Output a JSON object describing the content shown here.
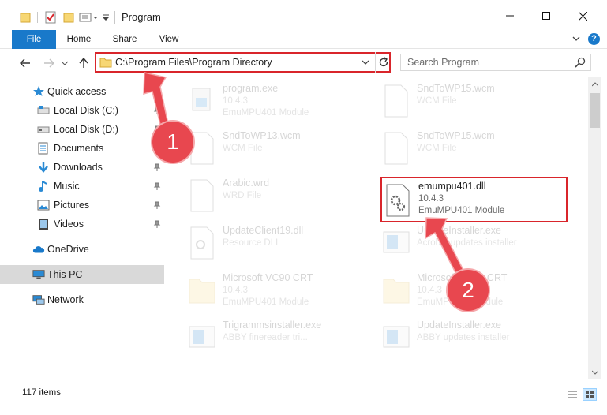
{
  "window": {
    "title": "Program",
    "controls": {
      "minimize": "minimize-icon",
      "maximize": "maximize-icon",
      "close": "close-icon"
    }
  },
  "ribbon": {
    "tabs": [
      {
        "label": "File",
        "active": true
      },
      {
        "label": "Home"
      },
      {
        "label": "Share"
      },
      {
        "label": "View"
      }
    ],
    "help": "?"
  },
  "navigation": {
    "address": "C:\\Program Files\\Program Directory",
    "search_placeholder": "Search Program"
  },
  "sidebar": {
    "quick_access": "Quick access",
    "items": [
      {
        "label": "Local Disk (C:)",
        "icon": "drive-icon",
        "pinned": true
      },
      {
        "label": "Local Disk (D:)",
        "icon": "drive-icon",
        "pinned": true
      },
      {
        "label": "Documents",
        "icon": "documents-icon",
        "pinned": true
      },
      {
        "label": "Downloads",
        "icon": "downloads-icon",
        "pinned": true
      },
      {
        "label": "Music",
        "icon": "music-icon",
        "pinned": true
      },
      {
        "label": "Pictures",
        "icon": "pictures-icon",
        "pinned": true
      },
      {
        "label": "Videos",
        "icon": "videos-icon",
        "pinned": true
      }
    ],
    "onedrive": "OneDrive",
    "this_pc": "This PC",
    "network": "Network"
  },
  "files": [
    {
      "name": "program.exe",
      "line2": "10.4.3",
      "line3": "EmuMPU401 Module",
      "icon": "exe-icon"
    },
    {
      "name": "SndToWP15.wcm",
      "line2": "WCM File",
      "line3": "",
      "icon": "blank-file-icon"
    },
    {
      "name": "SndToWP13.wcm",
      "line2": "WCM File",
      "line3": "",
      "icon": "blank-file-icon"
    },
    {
      "name": "SndToWP15.wcm",
      "line2": "WCM File",
      "line3": "",
      "icon": "blank-file-icon"
    },
    {
      "name": "Arabic.wrd",
      "line2": "WRD File",
      "line3": "",
      "icon": "blank-file-icon"
    },
    {
      "name": "emumpu401.dll",
      "line2": "10.4.3",
      "line3": "EmuMPU401 Module",
      "icon": "dll-gear-icon",
      "highlighted": true
    },
    {
      "name": "UpdateClient19.dll",
      "line2": "Resource DLL",
      "line3": "",
      "icon": "dll-icon"
    },
    {
      "name": "UpdateInstaller.exe",
      "line2": "Acrobat updates installer",
      "line3": "",
      "icon": "installer-icon"
    },
    {
      "name": "Microsoft VC90 CRT",
      "line2": "10.4.3",
      "line3": "EmuMPU401 Module",
      "icon": "folder-icon"
    },
    {
      "name": "Microsoft VC90 CRT",
      "line2": "10.4.3",
      "line3": "EmuMPU401 Module",
      "icon": "folder-icon"
    },
    {
      "name": "Trigrammsinstaller.exe",
      "line2": "ABBY finereader tri...",
      "line3": "",
      "icon": "installer-icon"
    },
    {
      "name": "UpdateInstaller.exe",
      "line2": "ABBY updates installer",
      "line3": "",
      "icon": "installer-icon"
    }
  ],
  "status": {
    "item_count": "117 items"
  },
  "annotations": [
    {
      "number": "1",
      "target": "address-bar"
    },
    {
      "number": "2",
      "target": "emumpu401.dll"
    }
  ],
  "colors": {
    "accent": "#1979ca",
    "highlight": "#d9252b",
    "callout": "#e8474f",
    "selected_nav": "#d9d9d9"
  }
}
